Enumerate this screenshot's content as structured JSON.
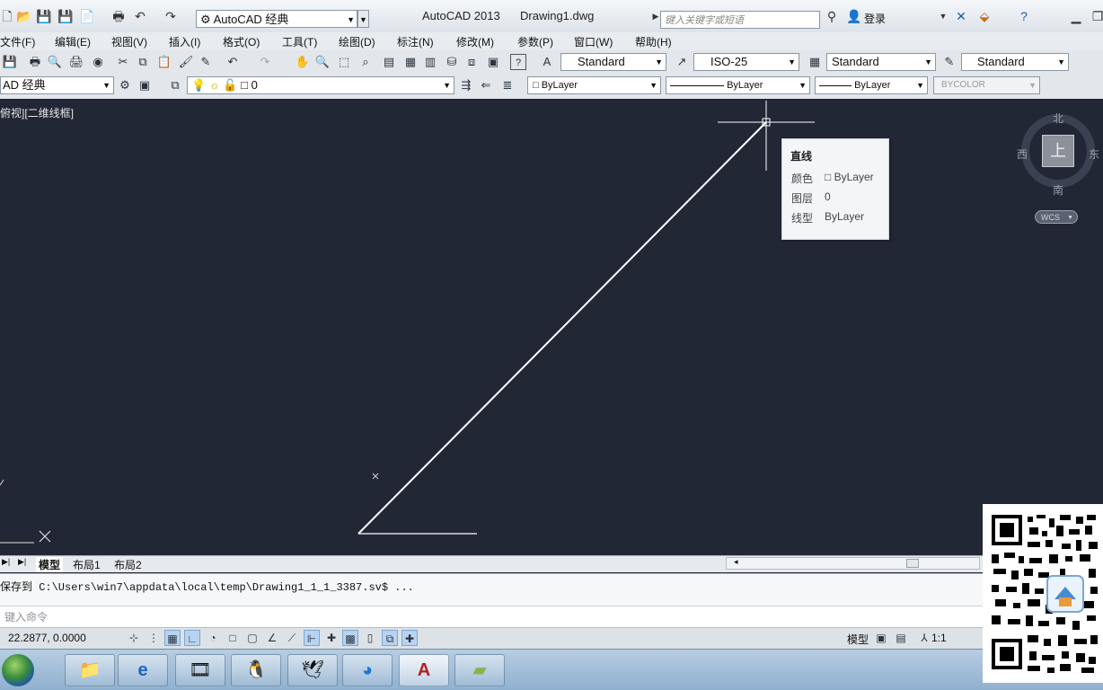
{
  "titlebar": {
    "workspace": "AutoCAD 经典",
    "app_title": "AutoCAD 2013",
    "doc_title": "Drawing1.dwg",
    "search_placeholder": "键入关键字或短语",
    "login_label": "登录"
  },
  "menu": [
    "文件(F)",
    "编辑(E)",
    "视图(V)",
    "插入(I)",
    "格式(O)",
    "工具(T)",
    "绘图(D)",
    "标注(N)",
    "修改(M)",
    "参数(P)",
    "窗口(W)",
    "帮助(H)"
  ],
  "styles_toolbar": {
    "text_style": "Standard",
    "dim_style": "ISO-25",
    "table_style": "Standard",
    "multileader_style": "Standard"
  },
  "layers_toolbar": {
    "workspace": "AD 经典",
    "layer": "0",
    "color": "ByLayer",
    "linetype": "ByLayer",
    "lineweight": "ByLayer",
    "plotstyle": "BYCOLOR"
  },
  "viewport": {
    "view_label": "俯视][二维线框]"
  },
  "tooltip": {
    "title": "直线",
    "rows": [
      {
        "label": "颜色",
        "value": "ByLayer"
      },
      {
        "label": "图层",
        "value": "0"
      },
      {
        "label": "线型",
        "value": "ByLayer"
      }
    ]
  },
  "viewcube": {
    "north": "北",
    "south": "南",
    "east": "东",
    "west": "西",
    "face": "上",
    "wcs": "WCS"
  },
  "layout_tabs": [
    "模型",
    "布局1",
    "布局2"
  ],
  "command": {
    "history": "保存到 C:\\Users\\win7\\appdata\\local\\temp\\Drawing1_1_1_3387.sv$ ...",
    "placeholder": "键入命令"
  },
  "status": {
    "coords": "22.2877, 0.0000",
    "model": "模型",
    "scale": "1:1"
  },
  "colors": {
    "canvas": "#222736",
    "line": "#ffffff"
  }
}
